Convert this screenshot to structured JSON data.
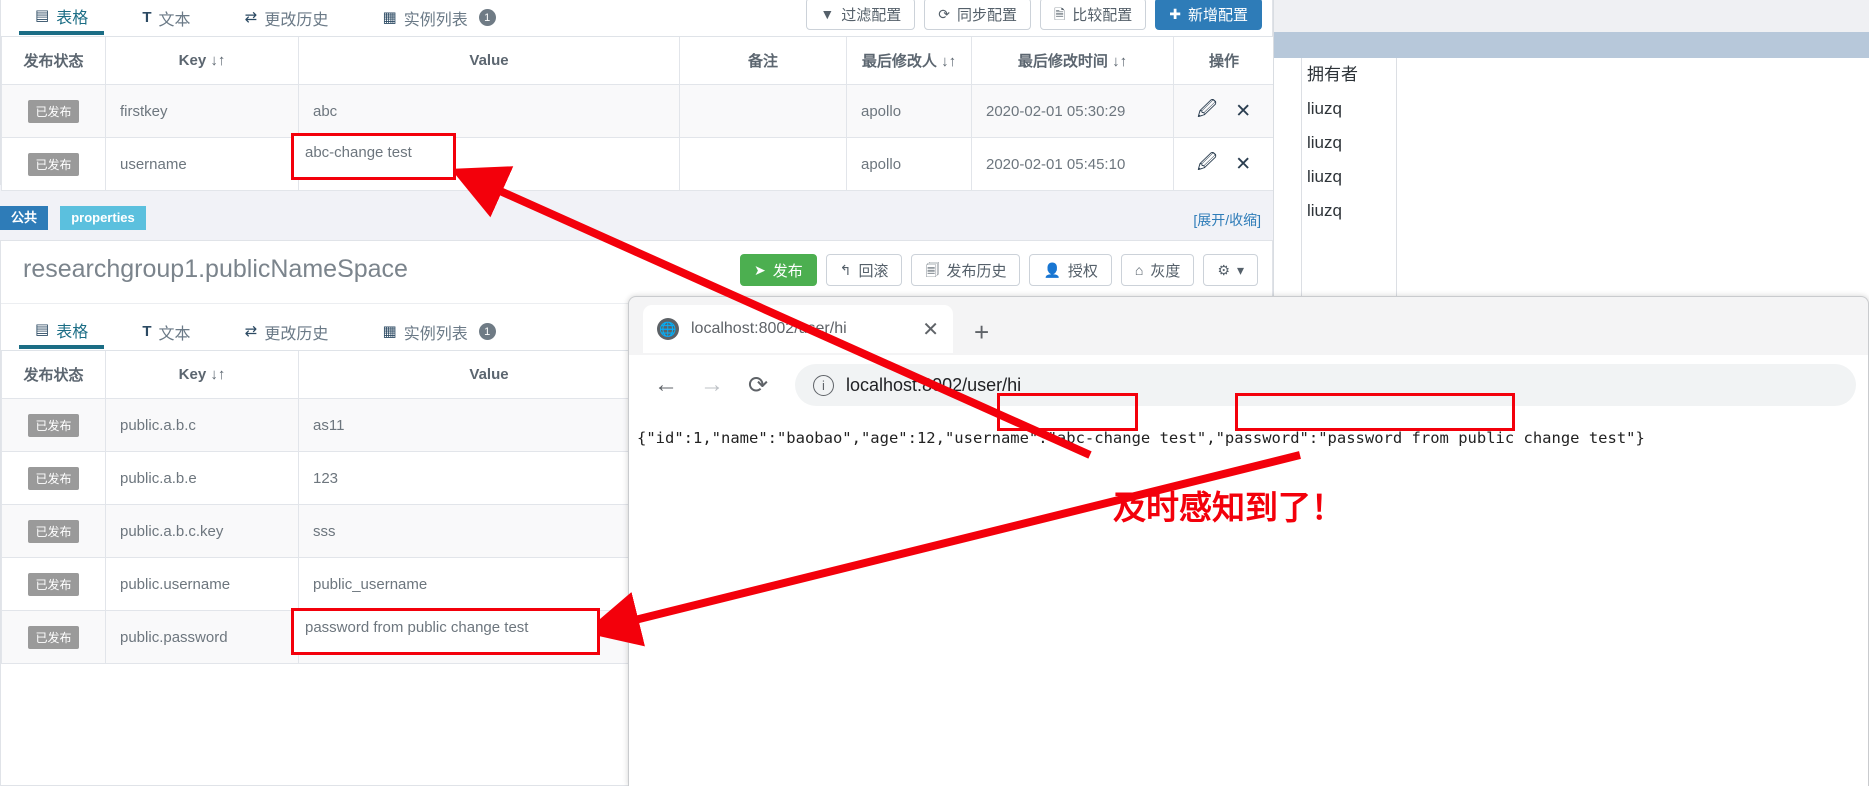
{
  "console": {
    "top_tabs": [
      {
        "label": "表格",
        "icon": "table-icon",
        "active": true,
        "badge": null
      },
      {
        "label": "文本",
        "icon": "text-icon",
        "active": false,
        "badge": null
      },
      {
        "label": "更改历史",
        "icon": "history-icon",
        "active": false,
        "badge": null
      },
      {
        "label": "实例列表",
        "icon": "instance-list-icon",
        "active": false,
        "badge": "1"
      }
    ],
    "top_buttons": [
      {
        "label": "过滤配置",
        "icon": "filter-icon",
        "style": "default"
      },
      {
        "label": "同步配置",
        "icon": "sync-icon",
        "style": "default"
      },
      {
        "label": "比较配置",
        "icon": "compare-icon",
        "style": "default"
      },
      {
        "label": "新增配置",
        "icon": "plus-icon",
        "style": "primary"
      }
    ],
    "table_top": {
      "columns": [
        "发布状态",
        "Key",
        "Value",
        "备注",
        "最后修改人",
        "最后修改时间",
        "操作"
      ],
      "sortable_columns": [
        "Key",
        "最后修改人",
        "最后修改时间"
      ],
      "rows": [
        {
          "status": "已发布",
          "key": "firstkey",
          "value": "abc",
          "comment": "",
          "modifier": "apollo",
          "modified": "2020-02-01 05:30:29"
        },
        {
          "status": "已发布",
          "key": "username",
          "value": "abc-change test",
          "comment": "",
          "modifier": "apollo",
          "modified": "2020-02-01 05:45:10"
        }
      ]
    },
    "namespace_tags": {
      "public": "公共",
      "format": "properties",
      "expand_link": "[展开/收缩]"
    },
    "namespace_title": "researchgroup1.publicNameSpace",
    "ns_buttons": [
      {
        "label": "发布",
        "icon": "send-icon",
        "style": "green"
      },
      {
        "label": "回滚",
        "icon": "rollback-icon",
        "style": "default"
      },
      {
        "label": "发布历史",
        "icon": "clipboard-icon",
        "style": "default"
      },
      {
        "label": "授权",
        "icon": "user-icon",
        "style": "default"
      },
      {
        "label": "灰度",
        "icon": "flask-icon",
        "style": "default"
      },
      {
        "label": "",
        "icon": "gear-icon",
        "style": "default",
        "caret": "▾"
      }
    ],
    "ns_tabs": [
      {
        "label": "表格",
        "icon": "table-icon",
        "active": true,
        "badge": null
      },
      {
        "label": "文本",
        "icon": "text-icon",
        "active": false,
        "badge": null
      },
      {
        "label": "更改历史",
        "icon": "history-icon",
        "active": false,
        "badge": null
      },
      {
        "label": "实例列表",
        "icon": "instance-list-icon",
        "active": false,
        "badge": "1"
      }
    ],
    "table_bottom": {
      "columns": [
        "发布状态",
        "Key",
        "Value"
      ],
      "rows": [
        {
          "status": "已发布",
          "key": "public.a.b.c",
          "value": "as11"
        },
        {
          "status": "已发布",
          "key": "public.a.b.e",
          "value": "123"
        },
        {
          "status": "已发布",
          "key": "public.a.b.c.key",
          "value": "sss"
        },
        {
          "status": "已发布",
          "key": "public.username",
          "value": "public_username"
        },
        {
          "status": "已发布",
          "key": "public.password",
          "value": "password from public change test"
        }
      ]
    }
  },
  "right_panel": {
    "header": "拥有者",
    "owners": [
      "liuzq",
      "liuzq",
      "liuzq",
      "liuzq"
    ]
  },
  "browser": {
    "tab_title": "localhost:8002/user/hi",
    "tab_close": "✕",
    "new_tab": "+",
    "nav": {
      "back": "←",
      "forward": "→",
      "reload": "⟳",
      "info": "ⓘ"
    },
    "url": "localhost:8002/user/hi",
    "response": "{\"id\":1,\"name\":\"baobao\",\"age\":12,\"username\":\"abc-change test\",\"password\":\"password from public change test\"}"
  },
  "annotation": {
    "note": "及时感知到了！",
    "color": "#f3000b"
  }
}
